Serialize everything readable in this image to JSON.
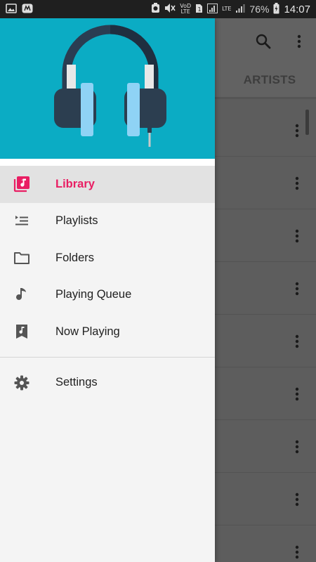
{
  "status_bar": {
    "volte_label_top": "VoD",
    "volte_label_bottom": "LTE",
    "lte_label": "LTE",
    "battery_percent": "76%",
    "time": "14:07"
  },
  "background_app": {
    "tab_label": "ARTISTS",
    "row_count": 9
  },
  "drawer": {
    "header_color": "#0bacc4",
    "accent_color": "#e91e63",
    "items": [
      {
        "label": "Library",
        "icon": "library-music-icon",
        "active": true
      },
      {
        "label": "Playlists",
        "icon": "playlist-icon",
        "active": false
      },
      {
        "label": "Folders",
        "icon": "folder-icon",
        "active": false
      },
      {
        "label": "Playing Queue",
        "icon": "music-note-icon",
        "active": false
      },
      {
        "label": "Now Playing",
        "icon": "now-playing-icon",
        "active": false
      }
    ],
    "settings": {
      "label": "Settings",
      "icon": "gear-icon"
    }
  }
}
